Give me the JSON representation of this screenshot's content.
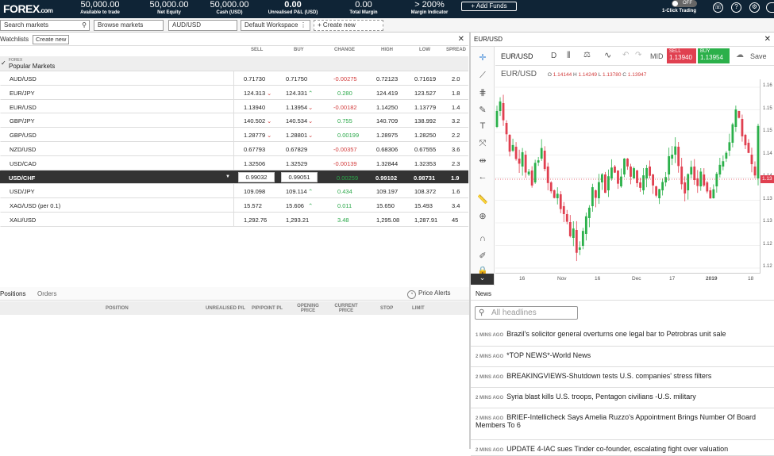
{
  "topbar": {
    "logo": "FOREX",
    "logo_suffix": ".com",
    "stats": [
      {
        "value": "50,000.00",
        "label": "Available to trade"
      },
      {
        "value": "50,000.00",
        "label": "Net Equity"
      },
      {
        "value": "50,000.00",
        "label": "Cash (USD)"
      },
      {
        "value": "0.00",
        "label": "Unrealised P&L (USD)"
      },
      {
        "value": "0.00",
        "label": "Total Margin"
      },
      {
        "value": "> 200%",
        "label": "Margin Indicator"
      }
    ],
    "add_funds": "+ Add Funds",
    "toggle": "OFF",
    "toggle_label": "1-Click Trading"
  },
  "tabbar": {
    "search_placeholder": "Search markets",
    "browse": "Browse markets",
    "symbol": "AUD/USD",
    "workspace": "Default Workspace",
    "create_new": "+ Create new"
  },
  "watchlist": {
    "title": "Watchlists",
    "create_new": "Create new",
    "columns": {
      "sell": "SELL",
      "buy": "BUY",
      "change": "CHANGE",
      "high": "HIGH",
      "low": "LOW",
      "spread": "SPREAD"
    },
    "group_sub": "FOREX",
    "group": "Popular Markets",
    "rows": [
      {
        "name": "AUD/USD",
        "sell": "0.71730",
        "buy": "0.71750",
        "change": "-0.00275",
        "dir": "dn",
        "high": "0.72123",
        "low": "0.71619",
        "spread": "2.0"
      },
      {
        "name": "EUR/JPY",
        "sell": "124.313",
        "buy": "124.331",
        "change": "0.280",
        "dir": "up",
        "high": "124.419",
        "low": "123.527",
        "spread": "1.8"
      },
      {
        "name": "EUR/USD",
        "sell": "1.13940",
        "buy": "1.13954",
        "change": "-0.00182",
        "dir": "dn",
        "high": "1.14250",
        "low": "1.13779",
        "spread": "1.4"
      },
      {
        "name": "GBP/JPY",
        "sell": "140.502",
        "buy": "140.534",
        "change": "0.755",
        "dir": "up",
        "high": "140.709",
        "low": "138.992",
        "spread": "3.2"
      },
      {
        "name": "GBP/USD",
        "sell": "1.28779",
        "buy": "1.28801",
        "change": "0.00199",
        "dir": "up",
        "high": "1.28975",
        "low": "1.28250",
        "spread": "2.2"
      },
      {
        "name": "NZD/USD",
        "sell": "0.67793",
        "buy": "0.67829",
        "change": "-0.00357",
        "dir": "dn",
        "high": "0.68306",
        "low": "0.67555",
        "spread": "3.6"
      },
      {
        "name": "USD/CAD",
        "sell": "1.32506",
        "buy": "1.32529",
        "change": "-0.00139",
        "dir": "dn",
        "high": "1.32844",
        "low": "1.32353",
        "spread": "2.3"
      },
      {
        "name": "USD/CHF",
        "sell": "0.99032",
        "buy": "0.99051",
        "change": "0.00259",
        "dir": "up",
        "high": "0.99102",
        "low": "0.98731",
        "spread": "1.9"
      },
      {
        "name": "USD/JPY",
        "sell": "109.098",
        "buy": "109.114",
        "change": "0.434",
        "dir": "up",
        "high": "109.197",
        "low": "108.372",
        "spread": "1.6"
      },
      {
        "name": "XAG/USD (per 0.1)",
        "sell": "15.572",
        "buy": "15.606",
        "change": "0.011",
        "dir": "up",
        "high": "15.650",
        "low": "15.493",
        "spread": "3.4"
      },
      {
        "name": "XAU/USD",
        "sell": "1,292.76",
        "buy": "1,293.21",
        "change": "3.48",
        "dir": "up",
        "high": "1,295.08",
        "low": "1,287.91",
        "spread": "45"
      }
    ]
  },
  "chart": {
    "panel_title": "EUR/USD",
    "symbol": "EUR/USD",
    "interval": "D",
    "mid": "MID",
    "sell_label": "SELL",
    "sell_price": "1.13940",
    "buy_label": "BUY",
    "buy_price": "1.13954",
    "save": "Save",
    "legend_symbol": "EUR/USD",
    "ohlc": {
      "o": "1.14144",
      "h": "1.14249",
      "l": "1.13780",
      "c": "1.13947"
    },
    "x_labels": [
      "16",
      "Nov",
      "16",
      "Dec",
      "17",
      "2019",
      "18"
    ],
    "y_labels": [
      "1.16",
      "1.15",
      "1.15",
      "1.14",
      "1.14",
      "1.13",
      "1.13",
      "1.12",
      "1.12"
    ],
    "last_price_tag": "1.13",
    "up_color": "#2bb04a",
    "down_color": "#e04050"
  },
  "positions": {
    "tabs": [
      "Positions",
      "Orders"
    ],
    "price_alerts": "Price Alerts",
    "columns": [
      "POSITION",
      "UNREALISED P/L",
      "PIP/POINT PL",
      "OPENING PRICE",
      "CURRENT PRICE",
      "STOP",
      "LIMIT"
    ]
  },
  "news": {
    "title": "News",
    "placeholder": "All headlines",
    "items": [
      {
        "time": "1 MINS AGO",
        "text": "Brazil's solicitor general overturns one legal bar to Petrobras unit sale"
      },
      {
        "time": "2 MINS AGO",
        "text": "*TOP NEWS*-World News"
      },
      {
        "time": "2 MINS AGO",
        "text": "BREAKINGVIEWS-Shutdown tests U.S. companies' stress filters"
      },
      {
        "time": "2 MINS AGO",
        "text": "Syria blast kills U.S. troops, Pentagon civilians -U.S. military"
      },
      {
        "time": "2 MINS AGO",
        "text": "BRIEF-Intellicheck Says Amelia Ruzzo's Appointment Brings Number Of Board Members To 6"
      },
      {
        "time": "2 MINS AGO",
        "text": "UPDATE 4-IAC sues Tinder co-founder, escalating fight over valuation"
      }
    ]
  }
}
